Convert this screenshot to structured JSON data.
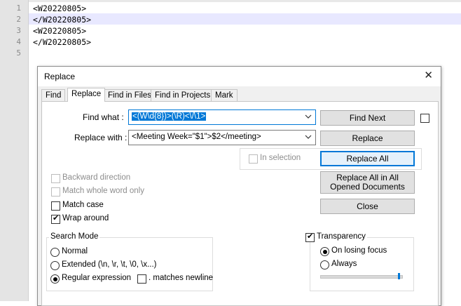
{
  "editor": {
    "line_numbers": [
      "1",
      "2",
      "3",
      "4",
      "5"
    ],
    "lines": [
      "<W20220805>",
      "</W20220805>",
      "<W20220805>",
      "</W20220805>",
      ""
    ]
  },
  "dialog": {
    "title": "Replace",
    "close_glyph": "✕",
    "tabs": [
      "Find",
      "Replace",
      "Find in Files",
      "Find in Projects",
      "Mark"
    ],
    "active_tab": "Replace",
    "find_what_label": "Find what :",
    "find_what_value": "<(W\\d{8})>(\\R)<\\/\\1>",
    "replace_with_label": "Replace with :",
    "replace_with_value": "<Meeting Week=\"$1\">$2</meeting>",
    "in_selection_label": "In selection",
    "buttons": {
      "find_next": "Find Next",
      "replace": "Replace",
      "replace_all": "Replace All",
      "replace_all_opened": "Replace All in All Opened Documents",
      "close": "Close"
    },
    "options": {
      "backward_direction": {
        "label": "Backward direction",
        "checked": false,
        "enabled": false
      },
      "match_whole_word": {
        "label": "Match whole word only",
        "checked": false,
        "enabled": false
      },
      "match_case": {
        "label": "Match case",
        "checked": false,
        "enabled": true
      },
      "wrap_around": {
        "label": "Wrap around",
        "checked": true,
        "enabled": true
      }
    },
    "search_mode": {
      "title": "Search Mode",
      "normal": "Normal",
      "extended": "Extended (\\n, \\r, \\t, \\0, \\x...)",
      "regular_expression": "Regular expression",
      "matches_newline": ". matches newline",
      "selected": "regular_expression",
      "matches_newline_checked": false
    },
    "transparency": {
      "label": "Transparency",
      "checked": true,
      "on_losing_focus": "On losing focus",
      "always": "Always",
      "selected": "on_losing_focus",
      "slider_level_fraction": 0.98
    },
    "accent_color": "#0078d7"
  }
}
